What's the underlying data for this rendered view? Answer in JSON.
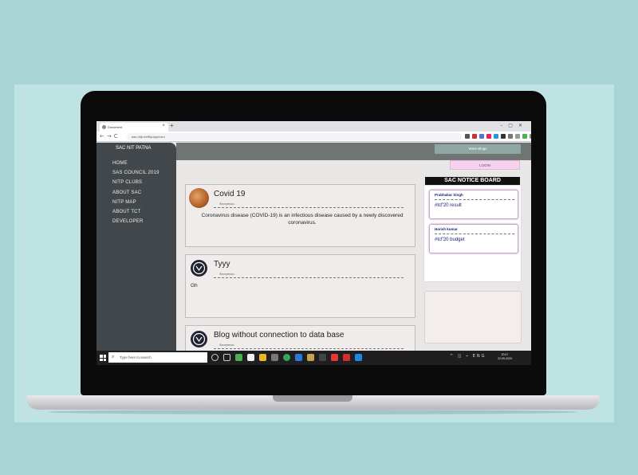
{
  "browser": {
    "tab_title": "Document",
    "tab_close": "×",
    "new_tab": "+",
    "window_controls": "–▢✕",
    "nav_buttons": "←→C",
    "url": "sac-nitp.netlify.app/com"
  },
  "site": {
    "brand": "SAC NIT PATNA",
    "menu": [
      "HOME",
      "SAS COUNCIL 2019",
      "NITP CLUBS",
      "ABOUT SAC",
      "NITP MAP",
      "ABOUT TCT",
      "DEVELOPER"
    ],
    "write_blogs": "Write Blogs",
    "login": "LOGIN",
    "posts": [
      {
        "title": "Covid 19",
        "author": "Anonymous",
        "body": "Coronavirus disease (COVID-19) is an infectious disease caused by a newly discovered coronavirus."
      },
      {
        "title": "Tyyy",
        "author": "Anonymous",
        "body": "Gh"
      },
      {
        "title": "Blog without connection to data base",
        "author": "Anonymous",
        "body": ""
      }
    ],
    "notice_board": {
      "title": "SAC NOTICE BOARD",
      "notices": [
        {
          "author": "Prabhakar Singh",
          "text": "#tcf'20 result"
        },
        {
          "author": "Harish kumar",
          "text": "#tcf'20 budget"
        }
      ]
    }
  },
  "taskbar": {
    "search_placeholder": "Type here to search",
    "tray_text": "^ ◫ ⌁ ENG",
    "time": "20:47",
    "date": "22-05-2020"
  },
  "colors": {
    "sidebar": "#41474a",
    "notice_title_bg": "#111111",
    "login_bg": "#f6d2ee",
    "write_blogs_bg": "#8fa6a3"
  },
  "icons": [
    "search-icon",
    "windows-logo-icon",
    "close-icon",
    "back-icon",
    "forward-icon",
    "reload-icon",
    "avatar-icon"
  ]
}
